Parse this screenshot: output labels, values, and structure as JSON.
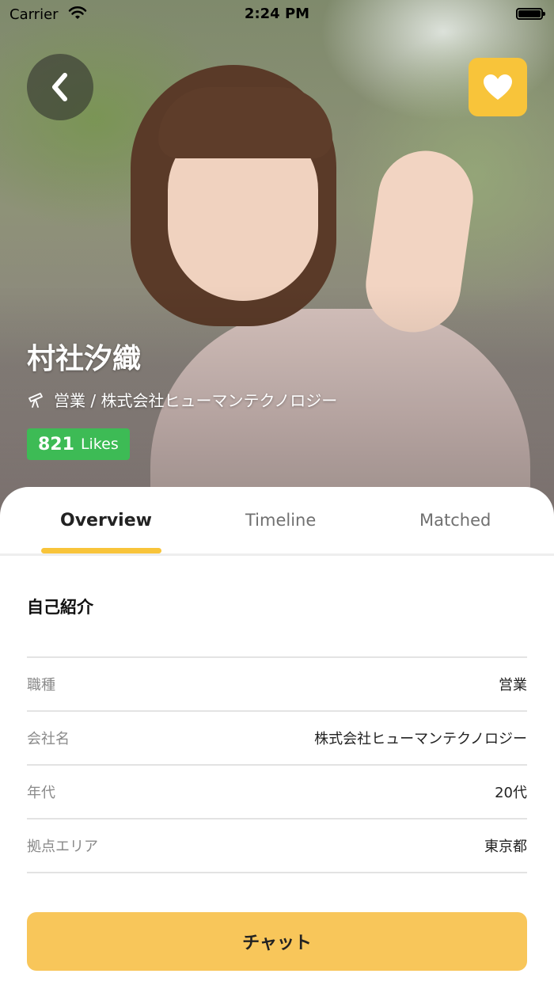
{
  "status_bar": {
    "carrier": "Carrier",
    "time": "2:24 PM"
  },
  "profile": {
    "name": "村社汐織",
    "job_line": "営業 / 株式会社ヒューマンテクノロジー",
    "likes_count": "821",
    "likes_label": "Likes"
  },
  "tabs": [
    {
      "label": "Overview",
      "active": true
    },
    {
      "label": "Timeline",
      "active": false
    },
    {
      "label": "Matched",
      "active": false
    }
  ],
  "overview": {
    "section_title": "自己紹介",
    "rows": [
      {
        "key": "職種",
        "value": "営業"
      },
      {
        "key": "会社名",
        "value": "株式会社ヒューマンテクノロジー"
      },
      {
        "key": "年代",
        "value": "20代"
      },
      {
        "key": "拠点エリア",
        "value": "東京都"
      }
    ]
  },
  "chat_button": "チャット",
  "colors": {
    "accent": "#f8c43a",
    "likes_badge": "#3dbb55",
    "chat_button": "#f8c65a"
  },
  "icons": {
    "back": "chevron-left-icon",
    "favorite": "heart-icon",
    "job": "telescope-icon",
    "wifi": "wifi-icon",
    "battery": "battery-icon"
  }
}
